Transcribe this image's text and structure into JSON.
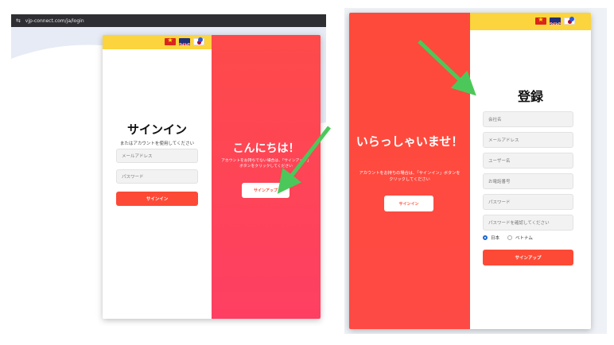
{
  "left_screen": {
    "url": "vjp-connect.com/ja/login",
    "signin": {
      "title": "サインイン",
      "subtitle": "またはアカウントを使用してください",
      "email_placeholder": "メールアドレス",
      "password_placeholder": "パスワード",
      "button": "サインイン"
    },
    "hello": {
      "title": "こんにちは！",
      "text": "アカウントをお持ちでない場合は、「サインアップ」ボタンをクリックしてください",
      "button": "サインアップ"
    }
  },
  "right_screen": {
    "welcome": {
      "title": "いらっしゃいませ！",
      "text": "アカウントをお持ちの場合は、「サインイン」ボタンをクリックしてください",
      "button": "サインイン"
    },
    "register": {
      "title": "登録",
      "fields": [
        {
          "placeholder": "会社名"
        },
        {
          "placeholder": "メールアドレス"
        },
        {
          "placeholder": "ユーザー名"
        },
        {
          "placeholder": "お電話番号"
        },
        {
          "placeholder": "パスワード"
        },
        {
          "placeholder": "パスワードを確認してください"
        }
      ],
      "radio_options": [
        {
          "label": "日本",
          "selected": true
        },
        {
          "label": "ベトナム",
          "selected": false
        }
      ],
      "button": "サインアップ"
    }
  },
  "colors": {
    "accent_red": "#fd4a36",
    "pink_panel": "#fe3f63",
    "yellow_band": "#fbd43e",
    "arrow_green": "#4cc85a"
  },
  "icons": [
    "vietnam-flag-icon",
    "uk-flag-icon",
    "japan-flag-icon",
    "tune-icon",
    "arrow-icon"
  ]
}
